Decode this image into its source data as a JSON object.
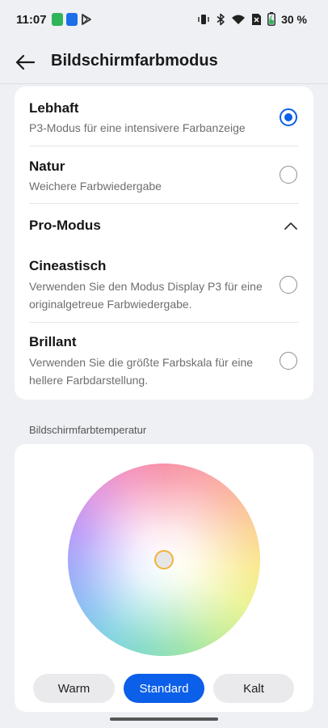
{
  "status_bar": {
    "time": "11:07",
    "battery": "30 %",
    "icons": [
      "notification-app-icon",
      "notification-app-icon",
      "play-store-icon",
      "vibrate-icon",
      "bluetooth-icon",
      "wifi-icon",
      "no-sim-icon",
      "battery-icon"
    ]
  },
  "header": {
    "title": "Bildschirmfarbmodus",
    "back_icon": "arrow-left-icon"
  },
  "modes": [
    {
      "title": "Lebhaft",
      "desc": "P3-Modus für eine intensivere Farbanzeige",
      "selected": true
    },
    {
      "title": "Natur",
      "desc": "Weichere Farbwiedergabe",
      "selected": false
    }
  ],
  "pro_section": {
    "title": "Pro-Modus",
    "expanded": true,
    "modes": [
      {
        "title": "Cineastisch",
        "desc": "Verwenden Sie den Modus Display P3 für eine originalgetreue Farbwiedergabe.",
        "selected": false
      },
      {
        "title": "Brillant",
        "desc": "Verwenden Sie die größte Farbskala für eine hellere Farbdarstellung.",
        "selected": false
      }
    ]
  },
  "temperature": {
    "label": "Bildschirmfarbtemperatur",
    "options": [
      "Warm",
      "Standard",
      "Kalt"
    ],
    "selected": "Standard"
  },
  "colors": {
    "accent": "#0b5fe8",
    "background": "#eff0f3",
    "card": "#ffffff",
    "handle_ring": "#f2b23a"
  }
}
